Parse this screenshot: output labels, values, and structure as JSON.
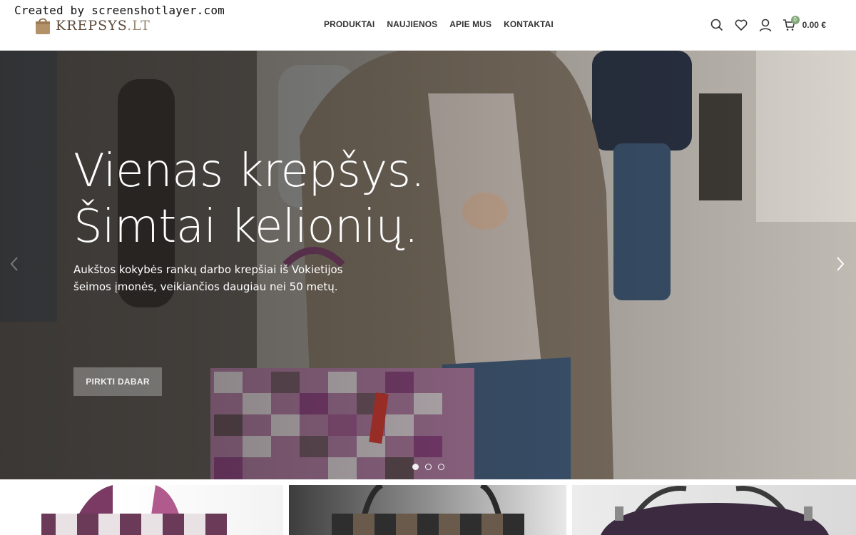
{
  "watermark": "Created by screenshotlayer.com",
  "logo": {
    "name": "KREPSYS",
    "tld": ".LT"
  },
  "nav": {
    "items": [
      {
        "label": "PRODUKTAI"
      },
      {
        "label": "NAUJIENOS"
      },
      {
        "label": "APIE MUS"
      },
      {
        "label": "KONTAKTAI"
      }
    ]
  },
  "tools": {
    "search_icon": "search-icon",
    "wishlist_icon": "heart-icon",
    "account_icon": "user-icon",
    "cart_icon": "cart-icon",
    "cart_count": "0",
    "cart_total": "0.00 €"
  },
  "hero": {
    "title_line1": "Vienas krepšys.",
    "title_line2": "Šimtai kelionių.",
    "subtitle": "Aukštos kokybės rankų darbo krepšiai iš Vokietijos šeimos įmonės, veikiančios daugiau nei 50 metų.",
    "cta": "PIRKTI DABAR",
    "slides": 3,
    "active_slide": 1
  },
  "colors": {
    "accent": "#83a87a",
    "logo_brown": "#5b4a3a",
    "nav_text": "#333333"
  }
}
